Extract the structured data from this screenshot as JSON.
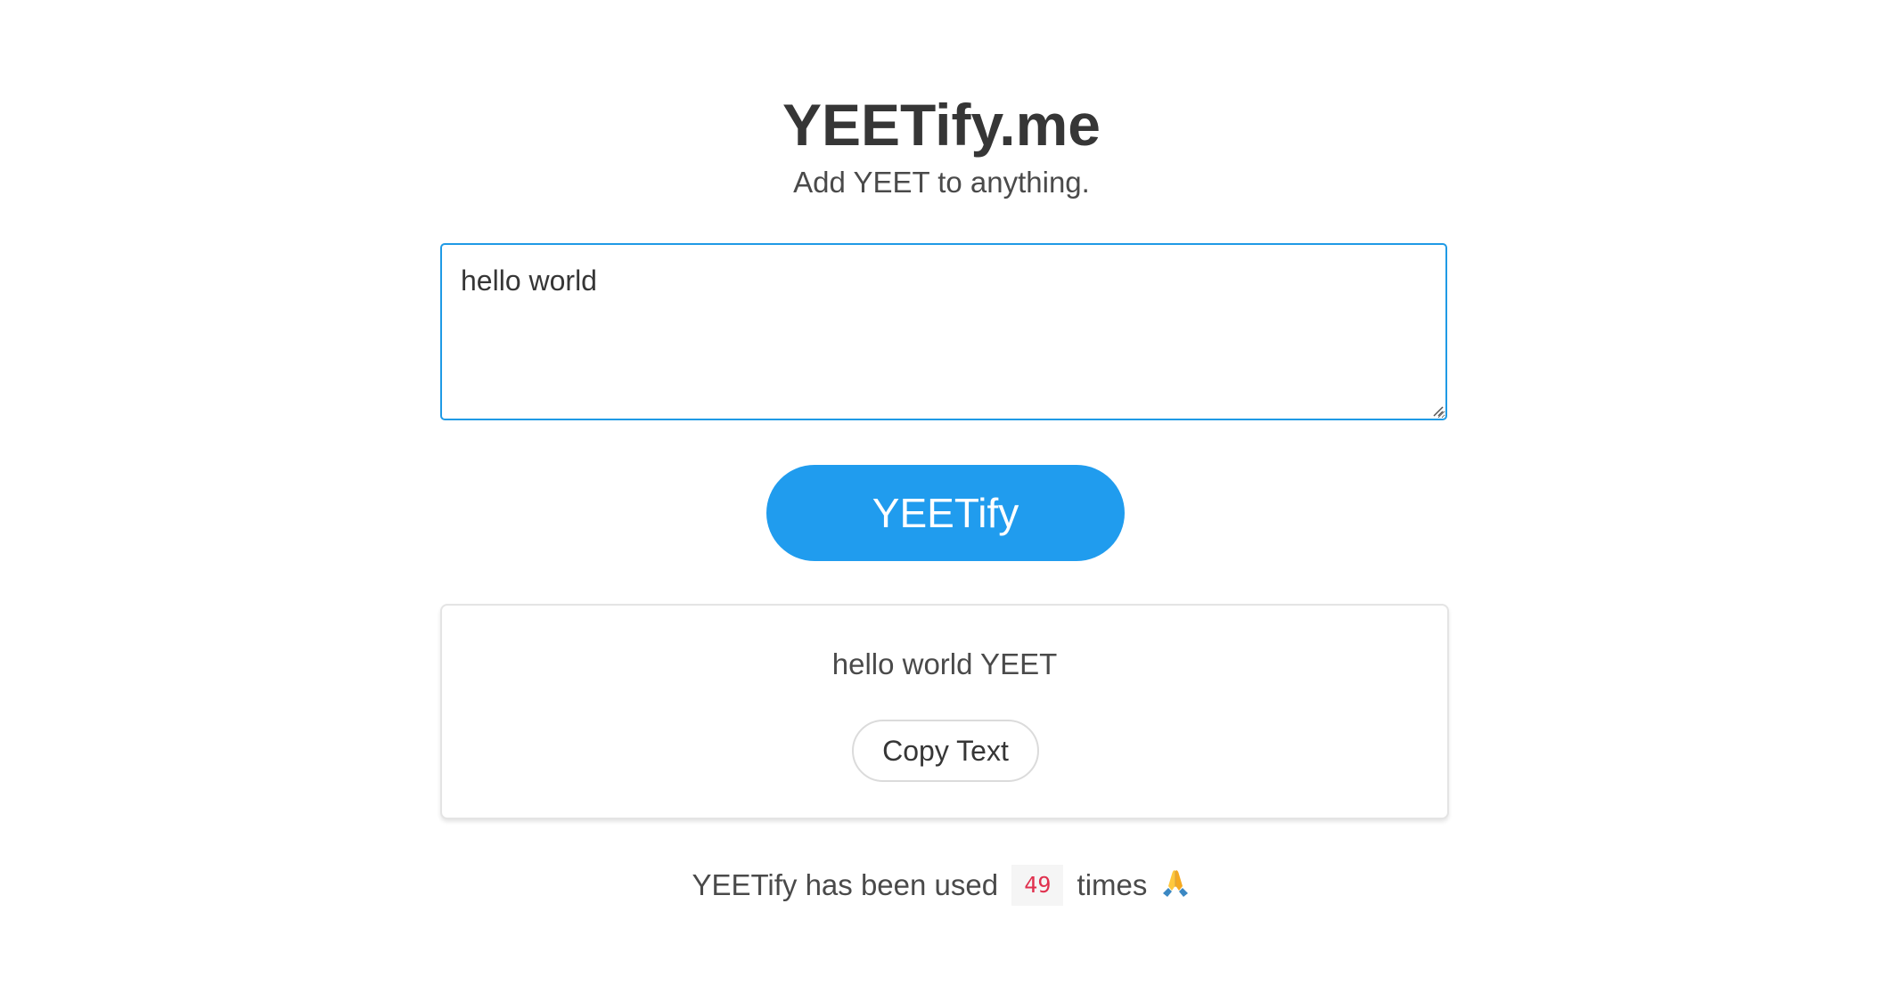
{
  "header": {
    "title": "YEETify.me",
    "subtitle": "Add YEET to anything."
  },
  "input": {
    "value": "hello world"
  },
  "actions": {
    "yeetify_label": "YEETify"
  },
  "result": {
    "text": "hello world YEET",
    "copy_label": "Copy Text"
  },
  "usage": {
    "prefix": "YEETify has been used",
    "count": "49",
    "suffix": "times",
    "icon": "folded-hands-icon"
  },
  "colors": {
    "accent": "#209cee",
    "focus_border": "#1f9ae5",
    "count_text": "#e0304e"
  }
}
